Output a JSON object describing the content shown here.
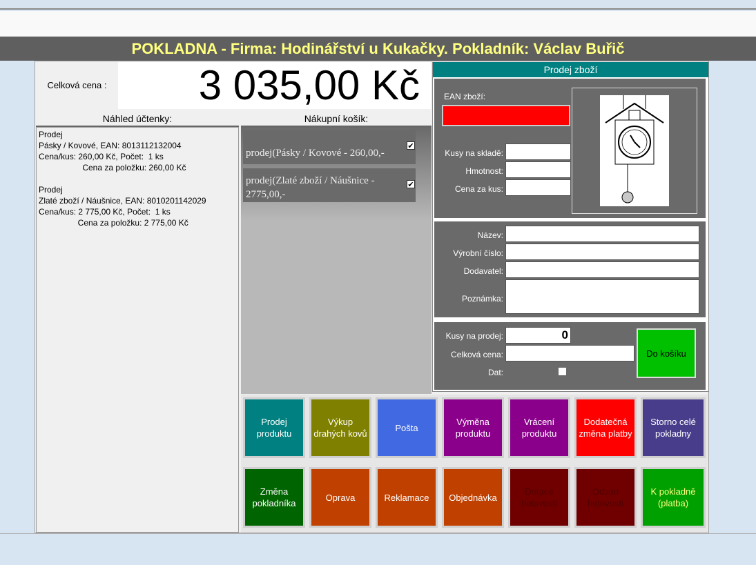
{
  "title": "POKLADNA - Firma: Hodinářství u Kukačky. Pokladník: Václav Buřič",
  "total": {
    "label": "Celková cena :",
    "value": "3 035,00 Kč"
  },
  "receipt": {
    "header": "Náhled účtenky:",
    "text": "Prodej\nPásky / Kovové, EAN: 8013112132004\nCena/kus: 260,00 Kč, Počet:  1 ks\n                   Cena za položku: 260,00 Kč\n\nProdej\nZlaté zboží / Náušnice, EAN: 8010201142029\nCena/kus: 2 775,00 Kč, Počet:  1 ks\n                 Cena za položku: 2 775,00 Kč"
  },
  "cart": {
    "header": "Nákupní košík:",
    "items": [
      {
        "label": "prodej(Pásky / Kovové - 260,00,-",
        "checked": "✔"
      },
      {
        "label": "prodej(Zlaté zboží / Náušnice - 2775,00,-",
        "checked": "✔"
      }
    ]
  },
  "sale": {
    "header": "Prodej zboží",
    "ean_label": "EAN zboží:",
    "ean_value": "",
    "stock_label": "Kusy na skladě:",
    "weight_label": "Hmotnost:",
    "unit_price_label": "Cena za kus:",
    "name_label": "Název:",
    "serial_label": "Výrobní číslo:",
    "supplier_label": "Dodavatel:",
    "note_label": "Poznámka:",
    "qty_label": "Kusy na prodej:",
    "qty_value": "0",
    "total_label": "Celková cena:",
    "gift_label": "Dat:",
    "add_button": "Do košíku",
    "add_color": "#00c000",
    "ean_color": "#ff0000"
  },
  "buttons_row1": [
    {
      "label": "Prodej produktu",
      "color": "#008080",
      "text": "#ffffff"
    },
    {
      "label": "Výkup drahých kovů",
      "color": "#808000",
      "text": "#ffffff"
    },
    {
      "label": "Pošta",
      "color": "#4169e1",
      "text": "#ffffff"
    },
    {
      "label": "Výměna produktu",
      "color": "#8b008b",
      "text": "#ffffff"
    },
    {
      "label": "Vrácení produktu",
      "color": "#8b008b",
      "text": "#ffffff"
    },
    {
      "label": "Dodatečná změna platby",
      "color": "#ff0000",
      "text": "#ffffff"
    },
    {
      "label": "Storno celé pokladny",
      "color": "#483d8b",
      "text": "#ffffff"
    }
  ],
  "buttons_row2": [
    {
      "label": "Změna pokladníka",
      "color": "#006400",
      "text": "#ffffff"
    },
    {
      "label": "Oprava",
      "color": "#c04000",
      "text": "#ffffff"
    },
    {
      "label": "Reklamace",
      "color": "#c04000",
      "text": "#ffffff"
    },
    {
      "label": "Objednávka",
      "color": "#c04000",
      "text": "#ffffff"
    },
    {
      "label": "Dotace hotovosti",
      "color": "#700000",
      "text": "#500000"
    },
    {
      "label": "Odvod hotovosti",
      "color": "#700000",
      "text": "#500000"
    },
    {
      "label": "K pokladně (platba)",
      "color": "#00a000",
      "text": "#ffff80"
    }
  ]
}
